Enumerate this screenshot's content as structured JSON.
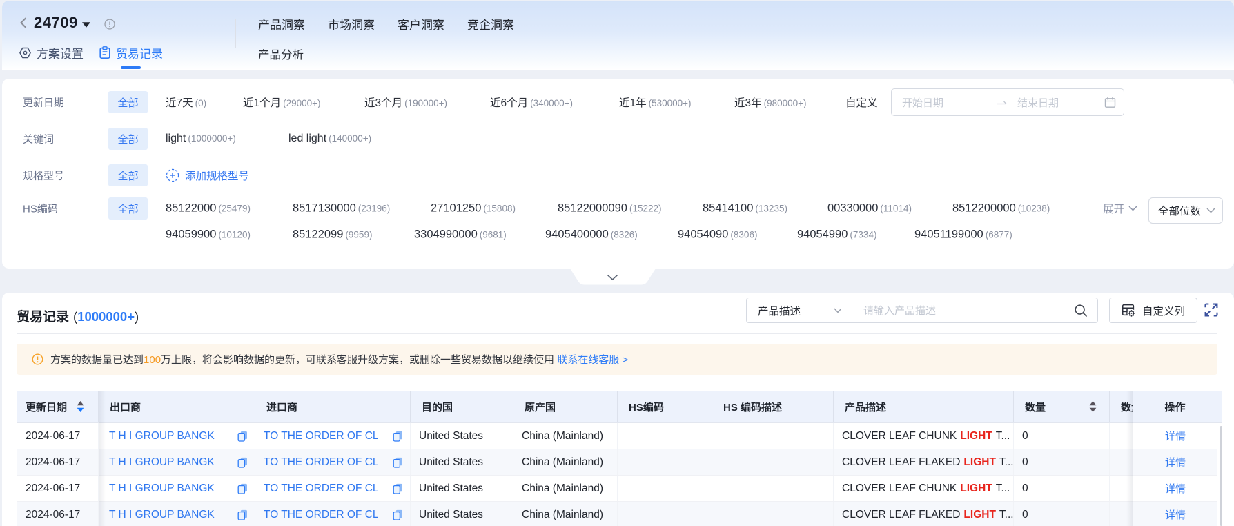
{
  "header": {
    "plan_id": "24709",
    "tab_settings": "方案设置",
    "tab_records": "贸易记录",
    "nav": [
      "产品洞察",
      "市场洞察",
      "客户洞察",
      "竞企洞察"
    ],
    "subnav": "产品分析"
  },
  "filters": {
    "all_label": "全部",
    "update_date": {
      "label": "更新日期",
      "options": [
        {
          "label": "近7天",
          "count": "(0)"
        },
        {
          "label": "近1个月",
          "count": "(29000+)"
        },
        {
          "label": "近3个月",
          "count": "(190000+)"
        },
        {
          "label": "近6个月",
          "count": "(340000+)"
        },
        {
          "label": "近1年",
          "count": "(530000+)"
        },
        {
          "label": "近3年",
          "count": "(980000+)"
        }
      ],
      "custom_label": "自定义",
      "start_placeholder": "开始日期",
      "end_placeholder": "结束日期"
    },
    "keywords": {
      "label": "关键词",
      "options": [
        {
          "label": "light",
          "count": "(1000000+)"
        },
        {
          "label": "led light",
          "count": "(140000+)"
        }
      ]
    },
    "spec_model": {
      "label": "规格型号",
      "add_label": "添加规格型号"
    },
    "hs_code": {
      "label": "HS编码",
      "line1": [
        {
          "label": "85122000",
          "count": "(25479)"
        },
        {
          "label": "8517130000",
          "count": "(23196)"
        },
        {
          "label": "27101250",
          "count": "(15808)"
        },
        {
          "label": "85122000090",
          "count": "(15222)"
        },
        {
          "label": "85414100",
          "count": "(13235)"
        },
        {
          "label": "00330000",
          "count": "(11014)"
        },
        {
          "label": "8512200000",
          "count": "(10238)"
        }
      ],
      "line2": [
        {
          "label": "94059900",
          "count": "(10120)"
        },
        {
          "label": "85122099",
          "count": "(9959)"
        },
        {
          "label": "3304990000",
          "count": "(9681)"
        },
        {
          "label": "9405400000",
          "count": "(8326)"
        },
        {
          "label": "94054090",
          "count": "(8306)"
        },
        {
          "label": "94054990",
          "count": "(7334)"
        },
        {
          "label": "94051199000",
          "count": "(6877)"
        }
      ],
      "expand_label": "展开",
      "digits_select": "全部位数"
    }
  },
  "records": {
    "title": "贸易记录",
    "count_open": "(",
    "count": "1000000+",
    "count_close": ")",
    "search_field": "产品描述",
    "search_placeholder": "请输入产品描述",
    "custom_columns": "自定义列",
    "alert": {
      "pre": "方案的数据量已达到",
      "highlight": "100",
      "mid": "万上限，将会影响数据的更新，可联系客服升级方案，或删除一些贸易数据以继续使用",
      "link": "联系在线客服",
      "arrow": ">"
    },
    "table": {
      "col_date": "更新日期",
      "col_exporter": "出口商",
      "col_importer": "进口商",
      "col_destination": "目的国",
      "col_origin": "原产国",
      "col_hs": "HS编码",
      "col_hs_desc": "HS 编码描述",
      "col_product": "产品描述",
      "col_qty": "数量",
      "col_qty_cut": "数量",
      "col_action": "操作",
      "rows": [
        {
          "date": "2024-06-17",
          "exporter": "T H I GROUP BANGK",
          "importer": "TO THE ORDER OF CL",
          "destination": "United States",
          "origin": "China (Mainland)",
          "hs": "",
          "hs_desc": "",
          "product_pre": "CLOVER LEAF CHUNK",
          "product_hl": "LIGHT",
          "product_post": "T...",
          "qty": "0",
          "action": "详情"
        },
        {
          "date": "2024-06-17",
          "exporter": "T H I GROUP BANGK",
          "importer": "TO THE ORDER OF CL",
          "destination": "United States",
          "origin": "China (Mainland)",
          "hs": "",
          "hs_desc": "",
          "product_pre": "CLOVER LEAF FLAKED",
          "product_hl": "LIGHT",
          "product_post": "T...",
          "qty": "0",
          "action": "详情"
        },
        {
          "date": "2024-06-17",
          "exporter": "T H I GROUP BANGK",
          "importer": "TO THE ORDER OF CL",
          "destination": "United States",
          "origin": "China (Mainland)",
          "hs": "",
          "hs_desc": "",
          "product_pre": "CLOVER LEAF CHUNK",
          "product_hl": "LIGHT",
          "product_post": "T...",
          "qty": "0",
          "action": "详情"
        },
        {
          "date": "2024-06-17",
          "exporter": "T H I GROUP BANGK",
          "importer": "TO THE ORDER OF CL",
          "destination": "United States",
          "origin": "China (Mainland)",
          "hs": "",
          "hs_desc": "",
          "product_pre": "CLOVER LEAF FLAKED",
          "product_hl": "LIGHT",
          "product_post": "T...",
          "qty": "0",
          "action": "详情"
        }
      ]
    }
  }
}
